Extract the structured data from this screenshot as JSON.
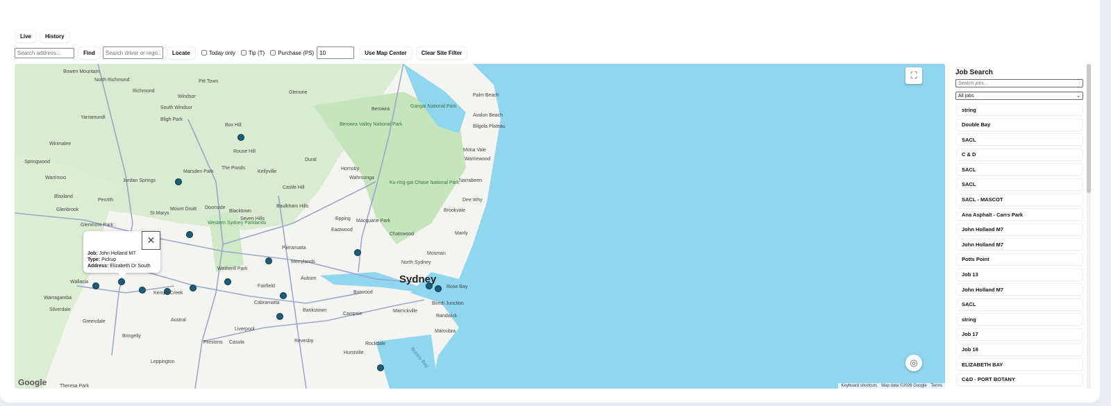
{
  "modes": [
    "Live",
    "History"
  ],
  "controls": {
    "address_placeholder": "Search address...",
    "find_label": "Find",
    "driver_placeholder": "Search driver or rego...",
    "locate_label": "Locate",
    "today_only_label": "Today only",
    "tip_label": "Tip (T)",
    "purchase_label": "Purchase (PS)",
    "radius_value": "10",
    "use_center_label": "Use Map Center",
    "clear_filter_label": "Clear Site Filter"
  },
  "map": {
    "popup": {
      "job_label": "Job:",
      "job_value": "John Holland M7",
      "type_label": "Type:",
      "type_value": "Pickup",
      "address_label": "Address:",
      "address_value": "Elizabeth Dr South",
      "close_icon": "close-icon"
    },
    "logo": "Google",
    "attribution": [
      "Keyboard shortcuts",
      "Map data ©2026 Google",
      "Terms"
    ],
    "colors": {
      "water": "#8fd6ee",
      "land": "#f3f3f0",
      "park": "#cfe8c6",
      "marker": "#1a5f7a"
    },
    "places": [
      {
        "name": "Bowen Mountain",
        "type": "suburb"
      },
      {
        "name": "North Richmond",
        "type": "suburb"
      },
      {
        "name": "Richmond",
        "type": "suburb"
      },
      {
        "name": "Windsor",
        "type": "suburb"
      },
      {
        "name": "South Windsor",
        "type": "suburb"
      },
      {
        "name": "Bligh Park",
        "type": "suburb"
      },
      {
        "name": "Yarramundi",
        "type": "suburb"
      },
      {
        "name": "Winmalee",
        "type": "suburb"
      },
      {
        "name": "Springwood",
        "type": "suburb"
      },
      {
        "name": "Warrimoo",
        "type": "suburb"
      },
      {
        "name": "Blaxland",
        "type": "suburb"
      },
      {
        "name": "Glenbrook",
        "type": "suburb"
      },
      {
        "name": "Penrith",
        "type": "suburb"
      },
      {
        "name": "Jordan Springs",
        "type": "suburb"
      },
      {
        "name": "Glenmore Park",
        "type": "suburb"
      },
      {
        "name": "Wallacia",
        "type": "suburb"
      },
      {
        "name": "Warragamba",
        "type": "suburb"
      },
      {
        "name": "Silverdale",
        "type": "suburb"
      },
      {
        "name": "Greendale",
        "type": "suburb"
      },
      {
        "name": "Bringelly",
        "type": "suburb"
      },
      {
        "name": "Leppington",
        "type": "suburb"
      },
      {
        "name": "Theresa Park",
        "type": "suburb"
      },
      {
        "name": "Pitt Town",
        "type": "suburb"
      },
      {
        "name": "Box Hill",
        "type": "suburb"
      },
      {
        "name": "Rouse Hill",
        "type": "suburb"
      },
      {
        "name": "Marsden Park",
        "type": "suburb"
      },
      {
        "name": "The Ponds",
        "type": "suburb"
      },
      {
        "name": "Kellyville",
        "type": "suburb"
      },
      {
        "name": "Glenorie",
        "type": "suburb"
      },
      {
        "name": "Dural",
        "type": "suburb"
      },
      {
        "name": "Castle Hill",
        "type": "suburb"
      },
      {
        "name": "Baulkham Hills",
        "type": "suburb"
      },
      {
        "name": "Mount Druitt",
        "type": "suburb"
      },
      {
        "name": "Doonside",
        "type": "suburb"
      },
      {
        "name": "Blacktown",
        "type": "suburb"
      },
      {
        "name": "Seven Hills",
        "type": "suburb"
      },
      {
        "name": "St Marys",
        "type": "suburb"
      },
      {
        "name": "Western Sydney Parklands",
        "type": "park"
      },
      {
        "name": "Wetherill Park",
        "type": "suburb"
      },
      {
        "name": "Parramatta",
        "type": "suburb"
      },
      {
        "name": "Merrylands",
        "type": "suburb"
      },
      {
        "name": "Fairfield",
        "type": "suburb"
      },
      {
        "name": "Cabramatta",
        "type": "suburb"
      },
      {
        "name": "Liverpool",
        "type": "suburb"
      },
      {
        "name": "Casula",
        "type": "suburb"
      },
      {
        "name": "Prestons",
        "type": "suburb"
      },
      {
        "name": "Austral",
        "type": "suburb"
      },
      {
        "name": "Kemps Creek",
        "type": "suburb"
      },
      {
        "name": "Bankstown",
        "type": "suburb"
      },
      {
        "name": "Revesby",
        "type": "suburb"
      },
      {
        "name": "Auburn",
        "type": "suburb"
      },
      {
        "name": "Burwood",
        "type": "suburb"
      },
      {
        "name": "Campsie",
        "type": "suburb"
      },
      {
        "name": "Marrickville",
        "type": "suburb"
      },
      {
        "name": "Rockdale",
        "type": "suburb"
      },
      {
        "name": "Hurstville",
        "type": "suburb"
      },
      {
        "name": "Eastwood",
        "type": "suburb"
      },
      {
        "name": "Epping",
        "type": "suburb"
      },
      {
        "name": "Macquarie Park",
        "type": "suburb"
      },
      {
        "name": "Chatswood",
        "type": "suburb"
      },
      {
        "name": "North Sydney",
        "type": "suburb"
      },
      {
        "name": "Mosman",
        "type": "suburb"
      },
      {
        "name": "Manly",
        "type": "suburb"
      },
      {
        "name": "Sydney",
        "type": "city"
      },
      {
        "name": "Rose Bay",
        "type": "suburb"
      },
      {
        "name": "Bondi Junction",
        "type": "suburb"
      },
      {
        "name": "Randwick",
        "type": "suburb"
      },
      {
        "name": "Maroubra",
        "type": "suburb"
      },
      {
        "name": "Hornsby",
        "type": "suburb"
      },
      {
        "name": "Wahroonga",
        "type": "suburb"
      },
      {
        "name": "Berowra",
        "type": "suburb"
      },
      {
        "name": "Berowra Valley National Park",
        "type": "park"
      },
      {
        "name": "Ku-ring-gai Chase National Park",
        "type": "park"
      },
      {
        "name": "Garigal National Park",
        "type": "park"
      },
      {
        "name": "Palm Beach",
        "type": "suburb"
      },
      {
        "name": "Avalon Beach",
        "type": "suburb"
      },
      {
        "name": "Bilgola Plateau",
        "type": "suburb"
      },
      {
        "name": "Mona Vale",
        "type": "suburb"
      },
      {
        "name": "Warriewood",
        "type": "suburb"
      },
      {
        "name": "Narrabeen",
        "type": "suburb"
      },
      {
        "name": "Dee Why",
        "type": "suburb"
      },
      {
        "name": "Brookvale",
        "type": "suburb"
      },
      {
        "name": "Botany Bay",
        "type": "water"
      }
    ]
  },
  "sidebar": {
    "title": "Job Search",
    "search_placeholder": "Search jobs...",
    "filter_value": "All jobs",
    "jobs": [
      "string",
      "Double Bay",
      "SACL",
      "C & D",
      "SACL",
      "SACL",
      "SACL - MASCOT",
      "Ana Asphalt - Carrs Park",
      "John Holland M7",
      "John Holland M7",
      "Potts Point",
      "Job 13",
      "John Holland M7",
      "SACL",
      "string",
      "Job 17",
      "Job 18",
      "ELIZABETH BAY",
      "C&D - PORT BOTANY"
    ]
  }
}
